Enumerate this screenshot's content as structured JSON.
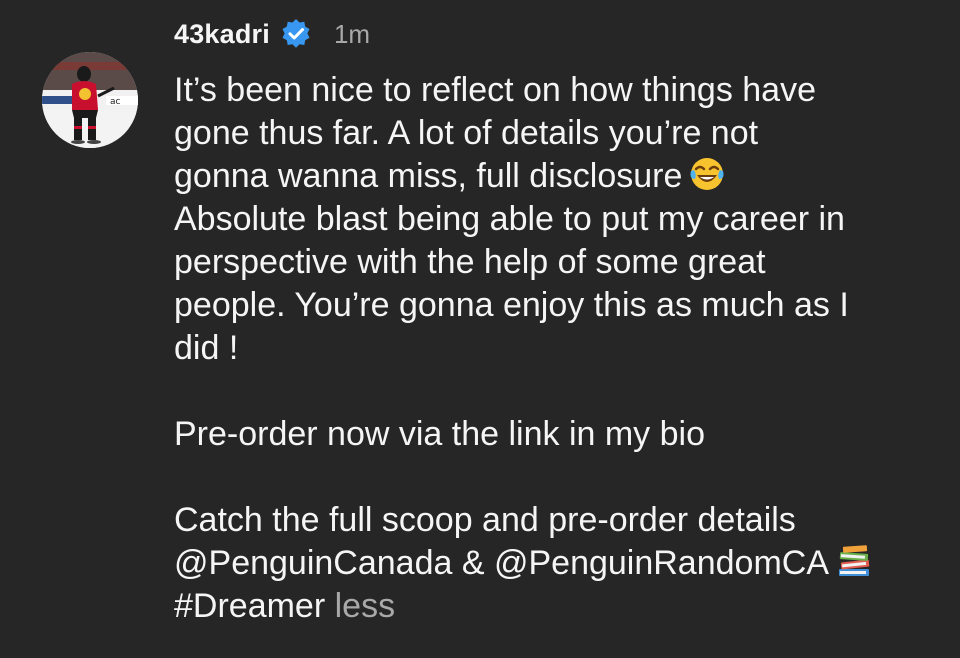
{
  "post": {
    "username": "43kadri",
    "timestamp": "1m",
    "verified_icon": "verified-badge-icon",
    "caption_lines_p1": [
      "It’s been nice to reflect on how things have",
      "gone thus far. A lot of details you’re not",
      "gonna wanna miss, full disclosure",
      "Absolute blast being able to put my career in",
      "perspective with the help of some great",
      "people. You’re gonna enjoy this as much as I",
      "did !"
    ],
    "caption_p2": "Pre-order now via the link in my bio",
    "caption_lines_p3": [
      "Catch the full scoop and pre-order details",
      "@PenguinCanada & @PenguinRandomCA",
      "#Dreamer"
    ],
    "less_label": "less",
    "emoji_1": "face-with-tears-of-joy-emoji",
    "emoji_2": "books-emoji"
  },
  "colors": {
    "background": "#262626",
    "text": "#f5f5f5",
    "secondary_text": "#a8a8a8",
    "verified_blue": "#3897f0"
  }
}
